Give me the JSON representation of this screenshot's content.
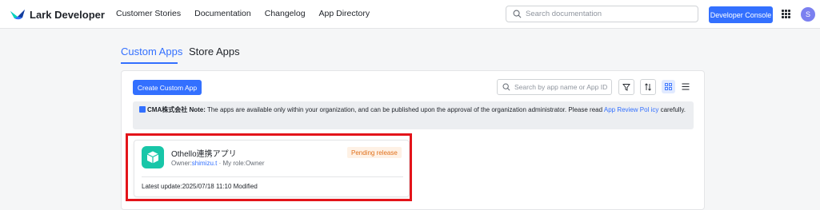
{
  "header": {
    "brand": "Lark Developer",
    "nav_links": [
      "Customer Stories",
      "Documentation",
      "Changelog",
      "App Directory"
    ],
    "search_placeholder": "Search documentation",
    "console_button": "Developer Console",
    "avatar_initial": "S"
  },
  "tabs": [
    {
      "label": "Custom Apps",
      "active": true
    },
    {
      "label": "Store Apps",
      "active": false
    }
  ],
  "toolbar": {
    "create_button": "Create Custom App",
    "search_placeholder": "Search by app name or App ID"
  },
  "notice": {
    "org": "CMA株式会社 Note:",
    "text": " The apps are available only within your organization, and can be published upon the approval of the organization administrator. Please read ",
    "link": "App Review Pol icy",
    "suffix": " carefully."
  },
  "app_card": {
    "name": "Othello連携アプリ",
    "status": "Pending release",
    "owner_label": "Owner:",
    "owner": "shimizu.t",
    "separator": "·",
    "role": "My role:Owner",
    "update": "Latest update:2025/07/18 11:10 Modified"
  },
  "colors": {
    "accent": "#3370ff",
    "app_icon": "#18c6a8",
    "status_text": "#e0701b",
    "status_bg": "#fef1e5",
    "highlight": "#e3141a"
  }
}
